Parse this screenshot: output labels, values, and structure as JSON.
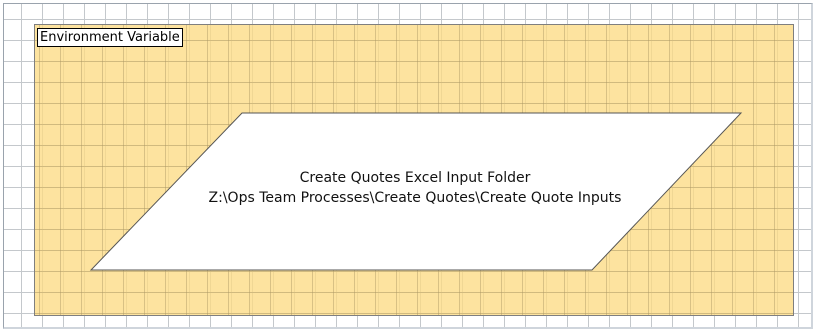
{
  "stage": {
    "title": "Environment Variable",
    "fill_color": "#fdd884",
    "grid_color": "#c4c8cc"
  },
  "data_item": {
    "shape": "parallelogram",
    "name": "Create Quotes Excel Input Folder",
    "value": "Z:\\Ops Team Processes\\Create Quotes\\Create Quote Inputs",
    "fill_color": "#ffffff",
    "stroke_color": "#555555"
  }
}
